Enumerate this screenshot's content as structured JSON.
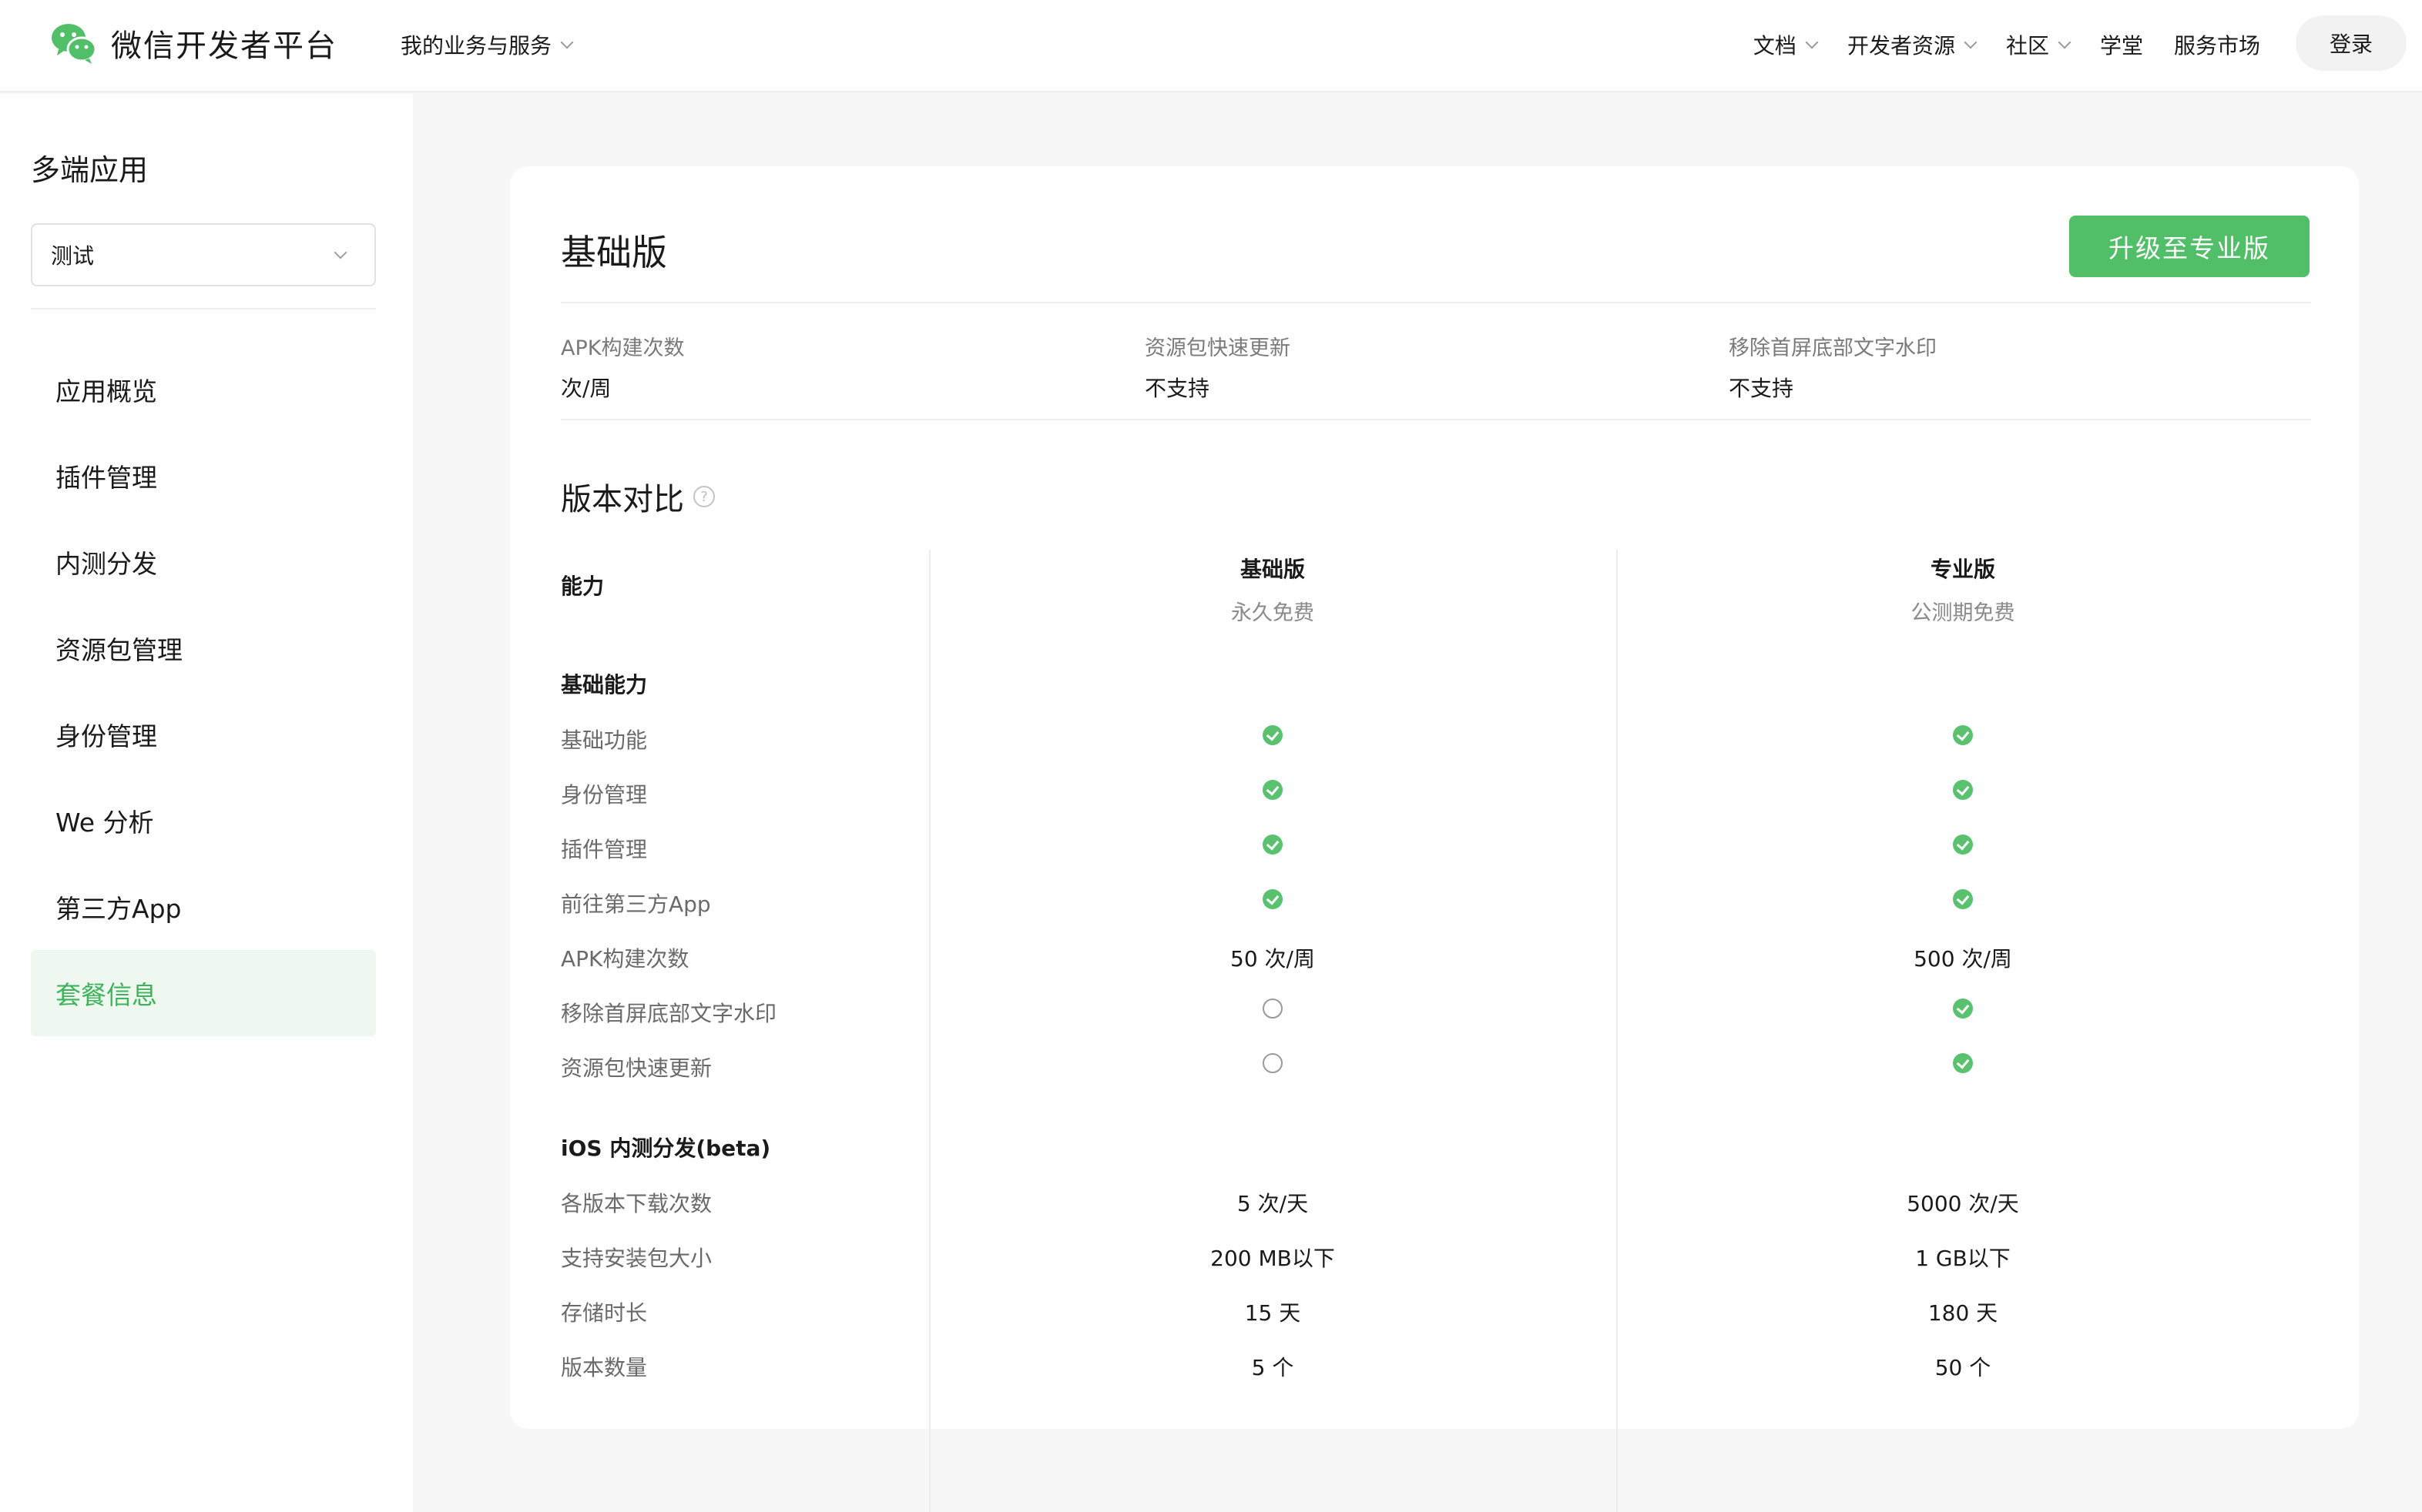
{
  "header": {
    "brand_name": "微信开发者平台",
    "biz_menu": "我的业务与服务",
    "nav": [
      "文档",
      "开发者资源",
      "社区",
      "学堂",
      "服务市场"
    ],
    "login": "登录"
  },
  "sidebar": {
    "title": "多端应用",
    "selected_app": "测试",
    "items": [
      "应用概览",
      "插件管理",
      "内测分发",
      "资源包管理",
      "身份管理",
      "We 分析",
      "第三方App",
      "套餐信息"
    ],
    "active_index": 7
  },
  "plan": {
    "title": "基础版",
    "upgrade_button": "升级至专业版",
    "stats": [
      {
        "label": "APK构建次数",
        "value": "次/周"
      },
      {
        "label": "资源包快速更新",
        "value": "不支持"
      },
      {
        "label": "移除首屏底部文字水印",
        "value": "不支持"
      }
    ]
  },
  "comparison": {
    "title": "版本对比",
    "capability_header": "能力",
    "columns": [
      {
        "name": "基础版",
        "price": "永久免费"
      },
      {
        "name": "专业版",
        "price": "公测期免费"
      }
    ],
    "sections": [
      {
        "title": "基础能力",
        "rows": [
          {
            "label": "基础功能",
            "basic": "check",
            "pro": "check"
          },
          {
            "label": "身份管理",
            "basic": "check",
            "pro": "check"
          },
          {
            "label": "插件管理",
            "basic": "check",
            "pro": "check"
          },
          {
            "label": "前往第三方App",
            "basic": "check",
            "pro": "check"
          },
          {
            "label": "APK构建次数",
            "basic": "50 次/周",
            "pro": "500 次/周"
          },
          {
            "label": "移除首屏底部文字水印",
            "basic": "empty",
            "pro": "check"
          },
          {
            "label": "资源包快速更新",
            "basic": "empty",
            "pro": "check"
          }
        ]
      },
      {
        "title": "iOS 内测分发(beta)",
        "rows": [
          {
            "label": "各版本下载次数",
            "basic": "5 次/天",
            "pro": "5000 次/天"
          },
          {
            "label": "支持安装包大小",
            "basic": "200 MB以下",
            "pro": "1 GB以下"
          },
          {
            "label": "存储时长",
            "basic": "15 天",
            "pro": "180 天"
          },
          {
            "label": "版本数量",
            "basic": "5 个",
            "pro": "50 个"
          }
        ]
      }
    ]
  },
  "icons": {
    "brand": "wechat-logo-icon",
    "help": "question-circle-icon",
    "supported": "check-circle-icon",
    "unsupported": "empty-circle-icon"
  },
  "colors": {
    "brand_green": "#51bf67",
    "active_bg": "#eef8f0",
    "active_text": "#3eb35a"
  }
}
